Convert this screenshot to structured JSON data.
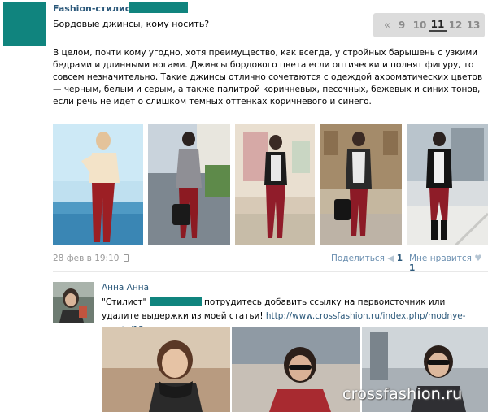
{
  "post": {
    "author": "Fashion-стилист",
    "title": "Бордовые джинсы, кому носить?",
    "body": "В целом, почти кому угодно, хотя преимущество, как всегда, у стройных барышень с узкими бедрами и длинными ногами. Джинсы бордового цвета если оптически и полнят фигуру, то совсем незначительно. Такие джинсы отлично сочетаются с одеждой ахроматических цветов — черным, белым и серым, а также палитрой коричневых, песочных, бежевых и синих тонов, если речь не идет о слишком темных оттенках коричневого и синего.",
    "date": "28 фев в 19:10",
    "share_label": "Поделиться",
    "share_count": "1",
    "like_label": "Мне нравится",
    "like_count": "1"
  },
  "pagination": {
    "prev": "«",
    "pages": [
      "9",
      "10",
      "11",
      "12",
      "13"
    ],
    "active": "11"
  },
  "comment": {
    "author": "Анна Анна",
    "text_prefix": "\"Стилист\"",
    "text_main": " потрудитесь добавить ссылку на первоисточник или удалите выдержки из моей статьи! ",
    "link": "http://www.crossfashion.ru/index.php/modnye-sovety/13.."
  },
  "watermark": "crossfashion.ru",
  "colors": {
    "accent_teal": "#10847e",
    "link_blue": "#2b587a",
    "muted": "#999999"
  }
}
